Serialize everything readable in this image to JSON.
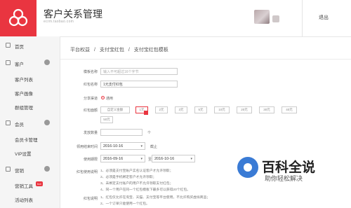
{
  "brand": {
    "title": "客户关系管理",
    "subtitle": "ecrm.taobao.com",
    "accent": "#e93540"
  },
  "header": {
    "logout_label": "退出"
  },
  "sidebar": {
    "groups": [
      {
        "label": "首页",
        "items": []
      },
      {
        "label": "客户",
        "items": [
          "客户列表",
          "客户画像",
          "群组管理"
        ]
      },
      {
        "label": "会员",
        "items": [
          "会员卡管理",
          "VIP设置"
        ]
      },
      {
        "label": "营销",
        "items": [
          "营销工具",
          "活动列表"
        ]
      }
    ],
    "hot_badge": "hot"
  },
  "breadcrumb": [
    "平台权益",
    "/",
    "支付宝红包",
    "/",
    "支付宝红包模板"
  ],
  "form": {
    "template_name_label": "模板名称",
    "template_name_placeholder": "输入不可超过16个字节",
    "redpack_name_label": "红包名称",
    "redpack_name_value": "1元支付红包",
    "share_label": "分享渠道",
    "share_value": "通用",
    "amount_label": "红包面额",
    "amount_custom": "自定义金额",
    "amounts": [
      "1元",
      "2元",
      "3元",
      "5元",
      "10元",
      "20元",
      "30元",
      "40元",
      "50元"
    ],
    "amount_selected": "1元",
    "qty_label": "发放数量",
    "qty_unit": "个",
    "collect_label": "领用结束时间",
    "collect_date": "2016-10-16",
    "collect_suffix": "截止",
    "use_label": "使用期限",
    "use_start": "2016-09-16",
    "use_to": "至",
    "use_end": "2016-10-16",
    "rules_label": "红包使用说明",
    "rules": [
      "1、必须是支付宝账户实名认证客户才允许领取；",
      "2、必须是手机绑定客户才允许领取；",
      "3、未绑定支付账户的用户不允许领取支付红包；",
      "4、同一个用户在同一个红包模板下最多可以获得20个红包。"
    ],
    "desc_label": "红包说明",
    "desc": [
      "1、红包仅允许在淘宝、天猫、支付宝等平台使用，不允许购买虚拟商品；",
      "2、一个订单只能使用一个红包。"
    ]
  },
  "watermark": {
    "title": "百科全说",
    "subtitle": "助你轻松解决"
  }
}
